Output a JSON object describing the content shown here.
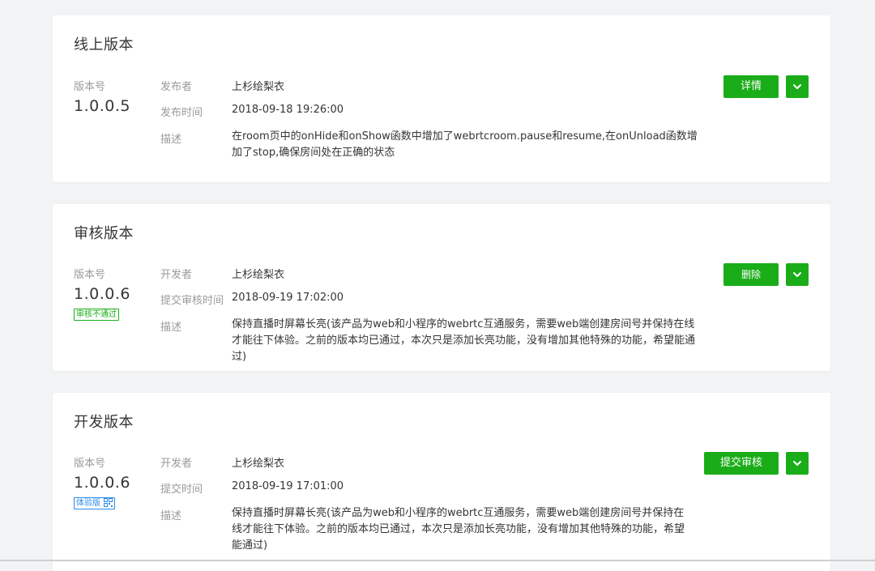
{
  "online": {
    "title": "线上版本",
    "version_label": "版本号",
    "version": "1.0.0.5",
    "author_label": "发布者",
    "author": "上杉绘梨衣",
    "time_label": "发布时间",
    "time": "2018-09-18 19:26:00",
    "desc_label": "描述",
    "desc": "在room页中的onHide和onShow函数中增加了webrtcroom.pause和resume,在onUnload函数增加了stop,确保房间处在正确的状态",
    "action_label": "详情"
  },
  "review": {
    "title": "审核版本",
    "version_label": "版本号",
    "version": "1.0.0.6",
    "status_badge": "审核不通过",
    "author_label": "开发者",
    "author": "上杉绘梨衣",
    "time_label": "提交审核时间",
    "time": "2018-09-19 17:02:00",
    "desc_label": "描述",
    "desc": "保持直播时屏幕长亮(该产品为web和小程序的webrtc互通服务，需要web端创建房间号并保持在线才能往下体验。之前的版本均已通过，本次只是添加长亮功能，没有增加其他特殊的功能，希望能通过)",
    "action_label": "删除"
  },
  "dev": {
    "title": "开发版本",
    "version_label": "版本号",
    "version": "1.0.0.6",
    "status_badge": "体验版",
    "author_label": "开发者",
    "author": "上杉绘梨衣",
    "time_label": "提交时间",
    "time": "2018-09-19 17:01:00",
    "desc_label": "描述",
    "desc": "保持直播时屏幕长亮(该产品为web和小程序的webrtc互通服务，需要web端创建房间号并保持在线才能往下体验。之前的版本均已通过，本次只是添加长亮功能，没有增加其他特殊的功能，希望能通过)",
    "action_label": "提交审核"
  },
  "colors": {
    "accent": "#1aad19",
    "badge_reject": "#1aad19",
    "badge_trial": "#2a8ae7"
  },
  "icons": {
    "dropdown": "chevron-down-icon",
    "qr": "qrcode-icon"
  }
}
